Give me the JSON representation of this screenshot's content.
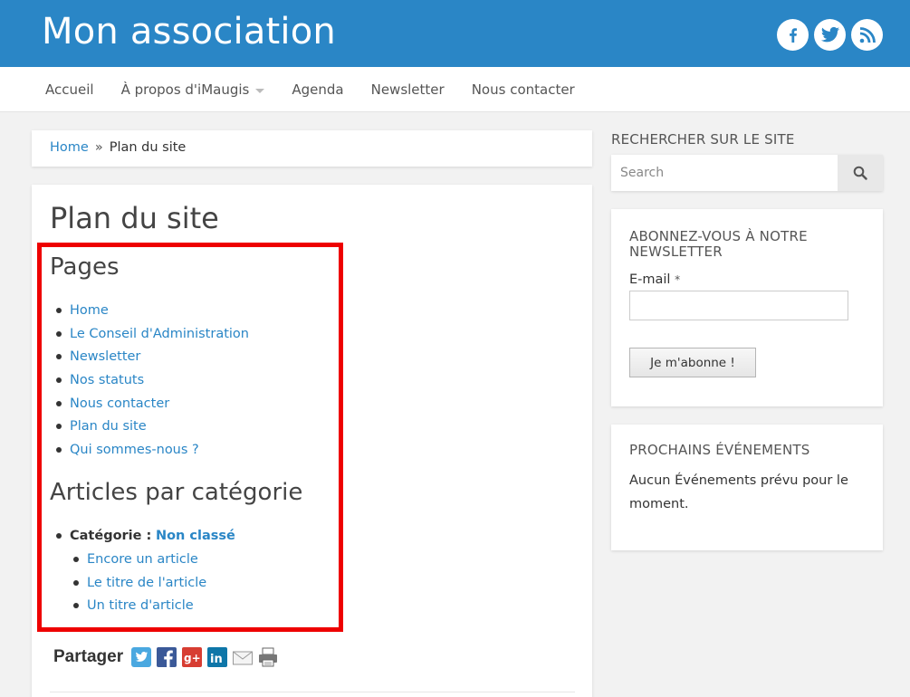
{
  "header": {
    "site_title": "Mon association",
    "social": [
      {
        "icon": "facebook-icon",
        "glyph": "f"
      },
      {
        "icon": "twitter-icon"
      },
      {
        "icon": "rss-icon"
      }
    ],
    "color": "#2a86c6"
  },
  "nav": {
    "items": [
      {
        "label": "Accueil"
      },
      {
        "label": "À propos d'iMaugis",
        "has_dropdown": true
      },
      {
        "label": "Agenda"
      },
      {
        "label": "Newsletter"
      },
      {
        "label": "Nous contacter"
      }
    ]
  },
  "breadcrumb": {
    "home": "Home",
    "separator": "»",
    "current": "Plan du site"
  },
  "main": {
    "title": "Plan du site",
    "pages_heading": "Pages",
    "pages": [
      "Home",
      "Le Conseil d'Administration",
      "Newsletter",
      "Nos statuts",
      "Nous contacter",
      "Plan du site",
      "Qui sommes-nous ?"
    ],
    "articles_heading": "Articles par catégorie",
    "category_label": "Catégorie :",
    "category_name": "Non classé",
    "articles": [
      "Encore un article",
      "Le titre de l'article",
      "Un titre d'article"
    ],
    "share_label": "Partager",
    "share_icons": [
      "twitter-share-icon",
      "facebook-share-icon",
      "google-plus-share-icon",
      "linkedin-share-icon",
      "email-share-icon",
      "print-icon"
    ]
  },
  "sidebar": {
    "search_title": "RECHERCHER SUR LE SITE",
    "search_placeholder": "Search",
    "newsletter_title": "ABONNEZ-VOUS À NOTRE NEWSLETTER",
    "email_label": "E-mail",
    "required_mark": "*",
    "subscribe_label": "Je m'abonne !",
    "events_title": "PROCHAINS ÉVÉNEMENTS",
    "events_text": "Aucun Événements prévu pour le moment."
  },
  "highlight_color": "#ee0000"
}
